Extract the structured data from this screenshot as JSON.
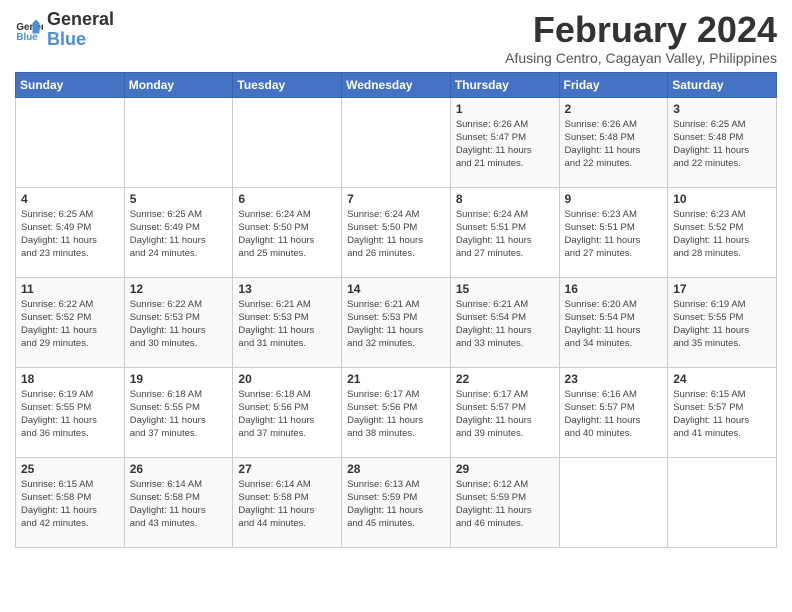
{
  "logo": {
    "line1": "General",
    "line2": "Blue"
  },
  "title": "February 2024",
  "subtitle": "Afusing Centro, Cagayan Valley, Philippines",
  "days_of_week": [
    "Sunday",
    "Monday",
    "Tuesday",
    "Wednesday",
    "Thursday",
    "Friday",
    "Saturday"
  ],
  "weeks": [
    [
      {
        "day": "",
        "info": ""
      },
      {
        "day": "",
        "info": ""
      },
      {
        "day": "",
        "info": ""
      },
      {
        "day": "",
        "info": ""
      },
      {
        "day": "1",
        "info": "Sunrise: 6:26 AM\nSunset: 5:47 PM\nDaylight: 11 hours\nand 21 minutes."
      },
      {
        "day": "2",
        "info": "Sunrise: 6:26 AM\nSunset: 5:48 PM\nDaylight: 11 hours\nand 22 minutes."
      },
      {
        "day": "3",
        "info": "Sunrise: 6:25 AM\nSunset: 5:48 PM\nDaylight: 11 hours\nand 22 minutes."
      }
    ],
    [
      {
        "day": "4",
        "info": "Sunrise: 6:25 AM\nSunset: 5:49 PM\nDaylight: 11 hours\nand 23 minutes."
      },
      {
        "day": "5",
        "info": "Sunrise: 6:25 AM\nSunset: 5:49 PM\nDaylight: 11 hours\nand 24 minutes."
      },
      {
        "day": "6",
        "info": "Sunrise: 6:24 AM\nSunset: 5:50 PM\nDaylight: 11 hours\nand 25 minutes."
      },
      {
        "day": "7",
        "info": "Sunrise: 6:24 AM\nSunset: 5:50 PM\nDaylight: 11 hours\nand 26 minutes."
      },
      {
        "day": "8",
        "info": "Sunrise: 6:24 AM\nSunset: 5:51 PM\nDaylight: 11 hours\nand 27 minutes."
      },
      {
        "day": "9",
        "info": "Sunrise: 6:23 AM\nSunset: 5:51 PM\nDaylight: 11 hours\nand 27 minutes."
      },
      {
        "day": "10",
        "info": "Sunrise: 6:23 AM\nSunset: 5:52 PM\nDaylight: 11 hours\nand 28 minutes."
      }
    ],
    [
      {
        "day": "11",
        "info": "Sunrise: 6:22 AM\nSunset: 5:52 PM\nDaylight: 11 hours\nand 29 minutes."
      },
      {
        "day": "12",
        "info": "Sunrise: 6:22 AM\nSunset: 5:53 PM\nDaylight: 11 hours\nand 30 minutes."
      },
      {
        "day": "13",
        "info": "Sunrise: 6:21 AM\nSunset: 5:53 PM\nDaylight: 11 hours\nand 31 minutes."
      },
      {
        "day": "14",
        "info": "Sunrise: 6:21 AM\nSunset: 5:53 PM\nDaylight: 11 hours\nand 32 minutes."
      },
      {
        "day": "15",
        "info": "Sunrise: 6:21 AM\nSunset: 5:54 PM\nDaylight: 11 hours\nand 33 minutes."
      },
      {
        "day": "16",
        "info": "Sunrise: 6:20 AM\nSunset: 5:54 PM\nDaylight: 11 hours\nand 34 minutes."
      },
      {
        "day": "17",
        "info": "Sunrise: 6:19 AM\nSunset: 5:55 PM\nDaylight: 11 hours\nand 35 minutes."
      }
    ],
    [
      {
        "day": "18",
        "info": "Sunrise: 6:19 AM\nSunset: 5:55 PM\nDaylight: 11 hours\nand 36 minutes."
      },
      {
        "day": "19",
        "info": "Sunrise: 6:18 AM\nSunset: 5:55 PM\nDaylight: 11 hours\nand 37 minutes."
      },
      {
        "day": "20",
        "info": "Sunrise: 6:18 AM\nSunset: 5:56 PM\nDaylight: 11 hours\nand 37 minutes."
      },
      {
        "day": "21",
        "info": "Sunrise: 6:17 AM\nSunset: 5:56 PM\nDaylight: 11 hours\nand 38 minutes."
      },
      {
        "day": "22",
        "info": "Sunrise: 6:17 AM\nSunset: 5:57 PM\nDaylight: 11 hours\nand 39 minutes."
      },
      {
        "day": "23",
        "info": "Sunrise: 6:16 AM\nSunset: 5:57 PM\nDaylight: 11 hours\nand 40 minutes."
      },
      {
        "day": "24",
        "info": "Sunrise: 6:15 AM\nSunset: 5:57 PM\nDaylight: 11 hours\nand 41 minutes."
      }
    ],
    [
      {
        "day": "25",
        "info": "Sunrise: 6:15 AM\nSunset: 5:58 PM\nDaylight: 11 hours\nand 42 minutes."
      },
      {
        "day": "26",
        "info": "Sunrise: 6:14 AM\nSunset: 5:58 PM\nDaylight: 11 hours\nand 43 minutes."
      },
      {
        "day": "27",
        "info": "Sunrise: 6:14 AM\nSunset: 5:58 PM\nDaylight: 11 hours\nand 44 minutes."
      },
      {
        "day": "28",
        "info": "Sunrise: 6:13 AM\nSunset: 5:59 PM\nDaylight: 11 hours\nand 45 minutes."
      },
      {
        "day": "29",
        "info": "Sunrise: 6:12 AM\nSunset: 5:59 PM\nDaylight: 11 hours\nand 46 minutes."
      },
      {
        "day": "",
        "info": ""
      },
      {
        "day": "",
        "info": ""
      }
    ]
  ]
}
